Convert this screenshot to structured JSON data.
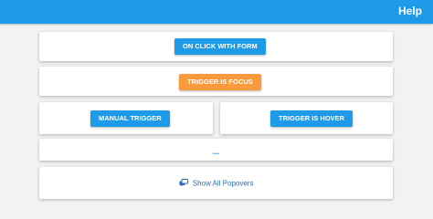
{
  "header": {
    "help_label": "Help"
  },
  "buttons": {
    "on_click_with_form": "ON CLICK WITH FORM",
    "trigger_is_focus": "TRIGGER IS FOCUS",
    "manual_trigger": "MANUAL TRIGGER",
    "trigger_is_hover": "TRIGGER IS HOVER"
  },
  "more_link": "...",
  "show_all": {
    "label": "Show All Popovers",
    "icon": "popovers-icon"
  },
  "colors": {
    "primary": "#1e9be8",
    "accent": "#f99a3d",
    "background": "#f2f2f2",
    "link": "#2a6fb0"
  }
}
